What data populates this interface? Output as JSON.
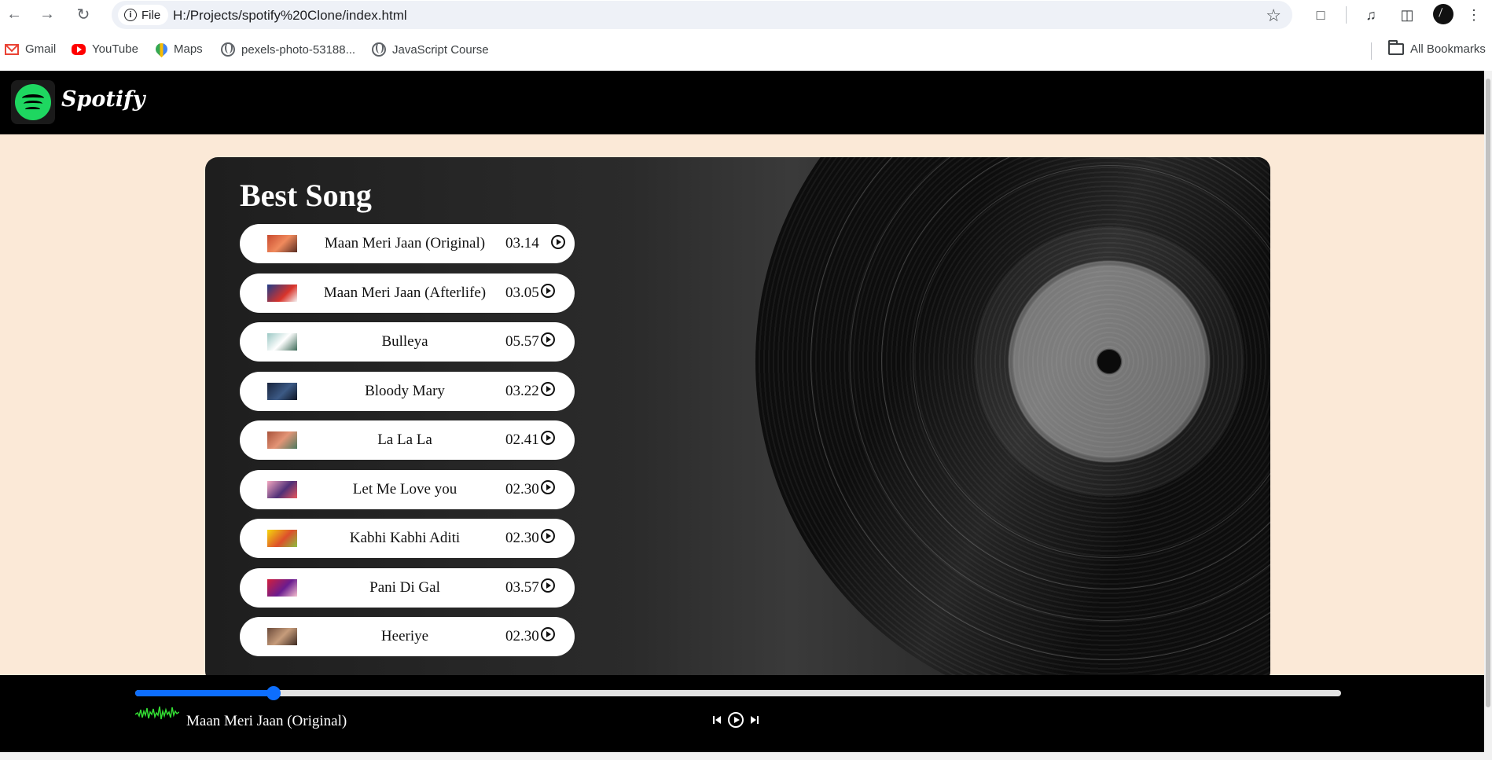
{
  "browser": {
    "site_chip": "File",
    "url": "H:/Projects/spotify%20Clone/index.html",
    "bookmarks": [
      {
        "label": "Gmail",
        "icon": "gmail-icon"
      },
      {
        "label": "YouTube",
        "icon": "youtube-icon"
      },
      {
        "label": "Maps",
        "icon": "maps-icon"
      },
      {
        "label": "pexels-photo-53188...",
        "icon": "globe-icon"
      },
      {
        "label": "JavaScript Course",
        "icon": "globe-icon"
      }
    ],
    "all_bookmarks": "All Bookmarks"
  },
  "app": {
    "brand": "Spotify",
    "brand_color": "#1ed760"
  },
  "main": {
    "title": "Best Song",
    "songs": [
      {
        "name": "Maan Meri Jaan (Original)",
        "time": "03.14"
      },
      {
        "name": "Maan Meri Jaan (Afterlife)",
        "time": "03.05"
      },
      {
        "name": "Bulleya",
        "time": "05.57"
      },
      {
        "name": "Bloody Mary",
        "time": "03.22"
      },
      {
        "name": "La La La",
        "time": "02.41"
      },
      {
        "name": "Let Me Love you",
        "time": "02.30"
      },
      {
        "name": "Kabhi Kabhi Aditi",
        "time": "02.30"
      },
      {
        "name": "Pani Di Gal",
        "time": "03.57"
      },
      {
        "name": "Heeriye",
        "time": "02.30"
      }
    ]
  },
  "player": {
    "now_playing": "Maan Meri Jaan (Original)",
    "progress_percent": 11.5,
    "accent_color": "#0d6efd",
    "wave_color": "#33dd33"
  }
}
